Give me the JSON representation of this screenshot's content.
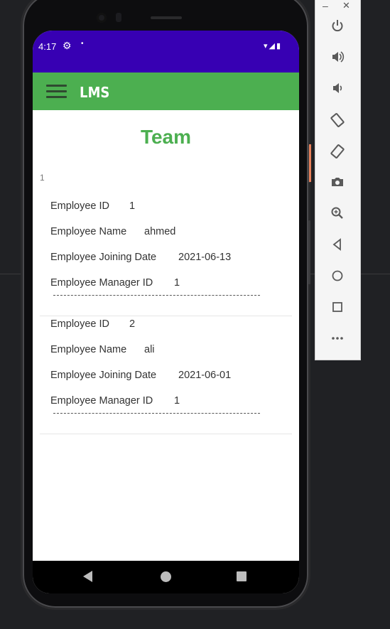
{
  "status_bar": {
    "time": "4:17",
    "gear_icon": "⚙",
    "dot_icon": "•",
    "signal_icons": "▾◢▮"
  },
  "app_bar": {
    "menu_icon": "hamburger-menu",
    "title": "LMS"
  },
  "page": {
    "title": "Team",
    "list_index": "1"
  },
  "labels": {
    "id": "Employee ID",
    "name": "Employee Name",
    "joining": "Employee Joining Date",
    "manager": "Employee Manager ID",
    "divider": "------------------------------------------------------------------------------------"
  },
  "employees": [
    {
      "id": "1",
      "name": "ahmed",
      "joining_date": "2021-06-13",
      "manager_id": "1"
    },
    {
      "id": "2",
      "name": "ali",
      "joining_date": "2021-06-01",
      "manager_id": "1"
    }
  ],
  "emulator_panel": {
    "minimize": "–",
    "close": "✕",
    "controls": [
      "power-icon",
      "volume-up-icon",
      "volume-down-icon",
      "rotate-left-icon",
      "rotate-right-icon",
      "camera-icon",
      "zoom-icon",
      "back-icon",
      "home-icon",
      "overview-icon",
      "more-icon"
    ]
  },
  "colors": {
    "status_bar": "#3700b3",
    "app_bar": "#4caf50",
    "title": "#4caf50"
  }
}
